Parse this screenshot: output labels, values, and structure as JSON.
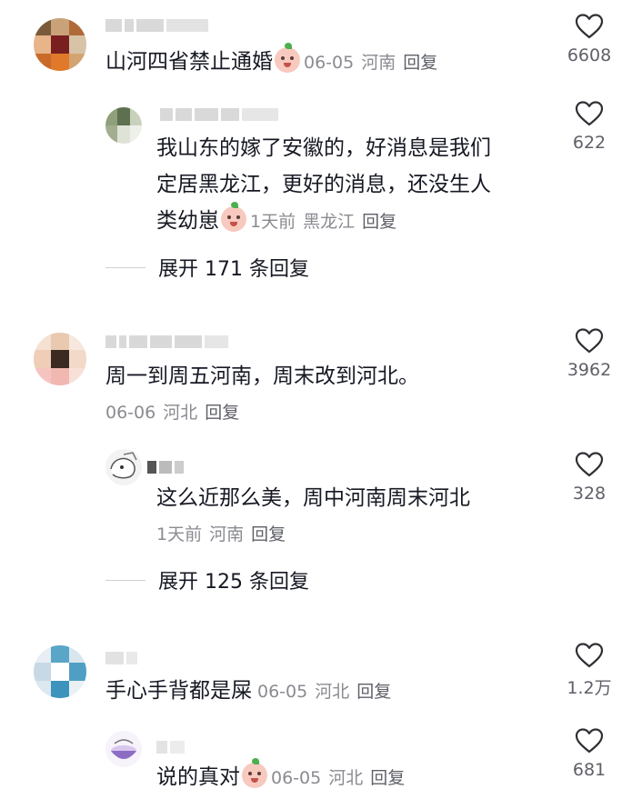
{
  "comments": [
    {
      "text": "山河四省禁止通婚",
      "date": "06-05",
      "location": "河南",
      "reply_label": "回复",
      "likes": "6608",
      "replies": [
        {
          "text_lines": [
            "我山东的嫁了安徽的，好消息是我们",
            "定居黑龙江，更好的消息，还没生人",
            "类幼崽"
          ],
          "date": "1天前",
          "location": "黑龙江",
          "reply_label": "回复",
          "likes": "622"
        }
      ],
      "expand_label": "展开 171 条回复"
    },
    {
      "text": "周一到周五河南，周末改到河北。",
      "date": "06-06",
      "location": "河北",
      "reply_label": "回复",
      "likes": "3962",
      "replies": [
        {
          "text_lines": [
            "这么近那么美，周中河南周末河北"
          ],
          "date": "1天前",
          "location": "河南",
          "reply_label": "回复",
          "likes": "328"
        }
      ],
      "expand_label": "展开 125 条回复"
    },
    {
      "text": "手心手背都是屎",
      "date": "06-05",
      "location": "河北",
      "reply_label": "回复",
      "likes": "1.2万",
      "replies": [
        {
          "text_lines": [
            "说的真对"
          ],
          "date": "06-05",
          "location": "河北",
          "reply_label": "回复",
          "likes": "681"
        }
      ]
    }
  ],
  "icons": {
    "like": "heart-outline-icon",
    "emoji": "peach-emoji-icon"
  },
  "colors": {
    "text": "#161823",
    "meta": "#8a8b91",
    "icon": "#2f3035"
  }
}
